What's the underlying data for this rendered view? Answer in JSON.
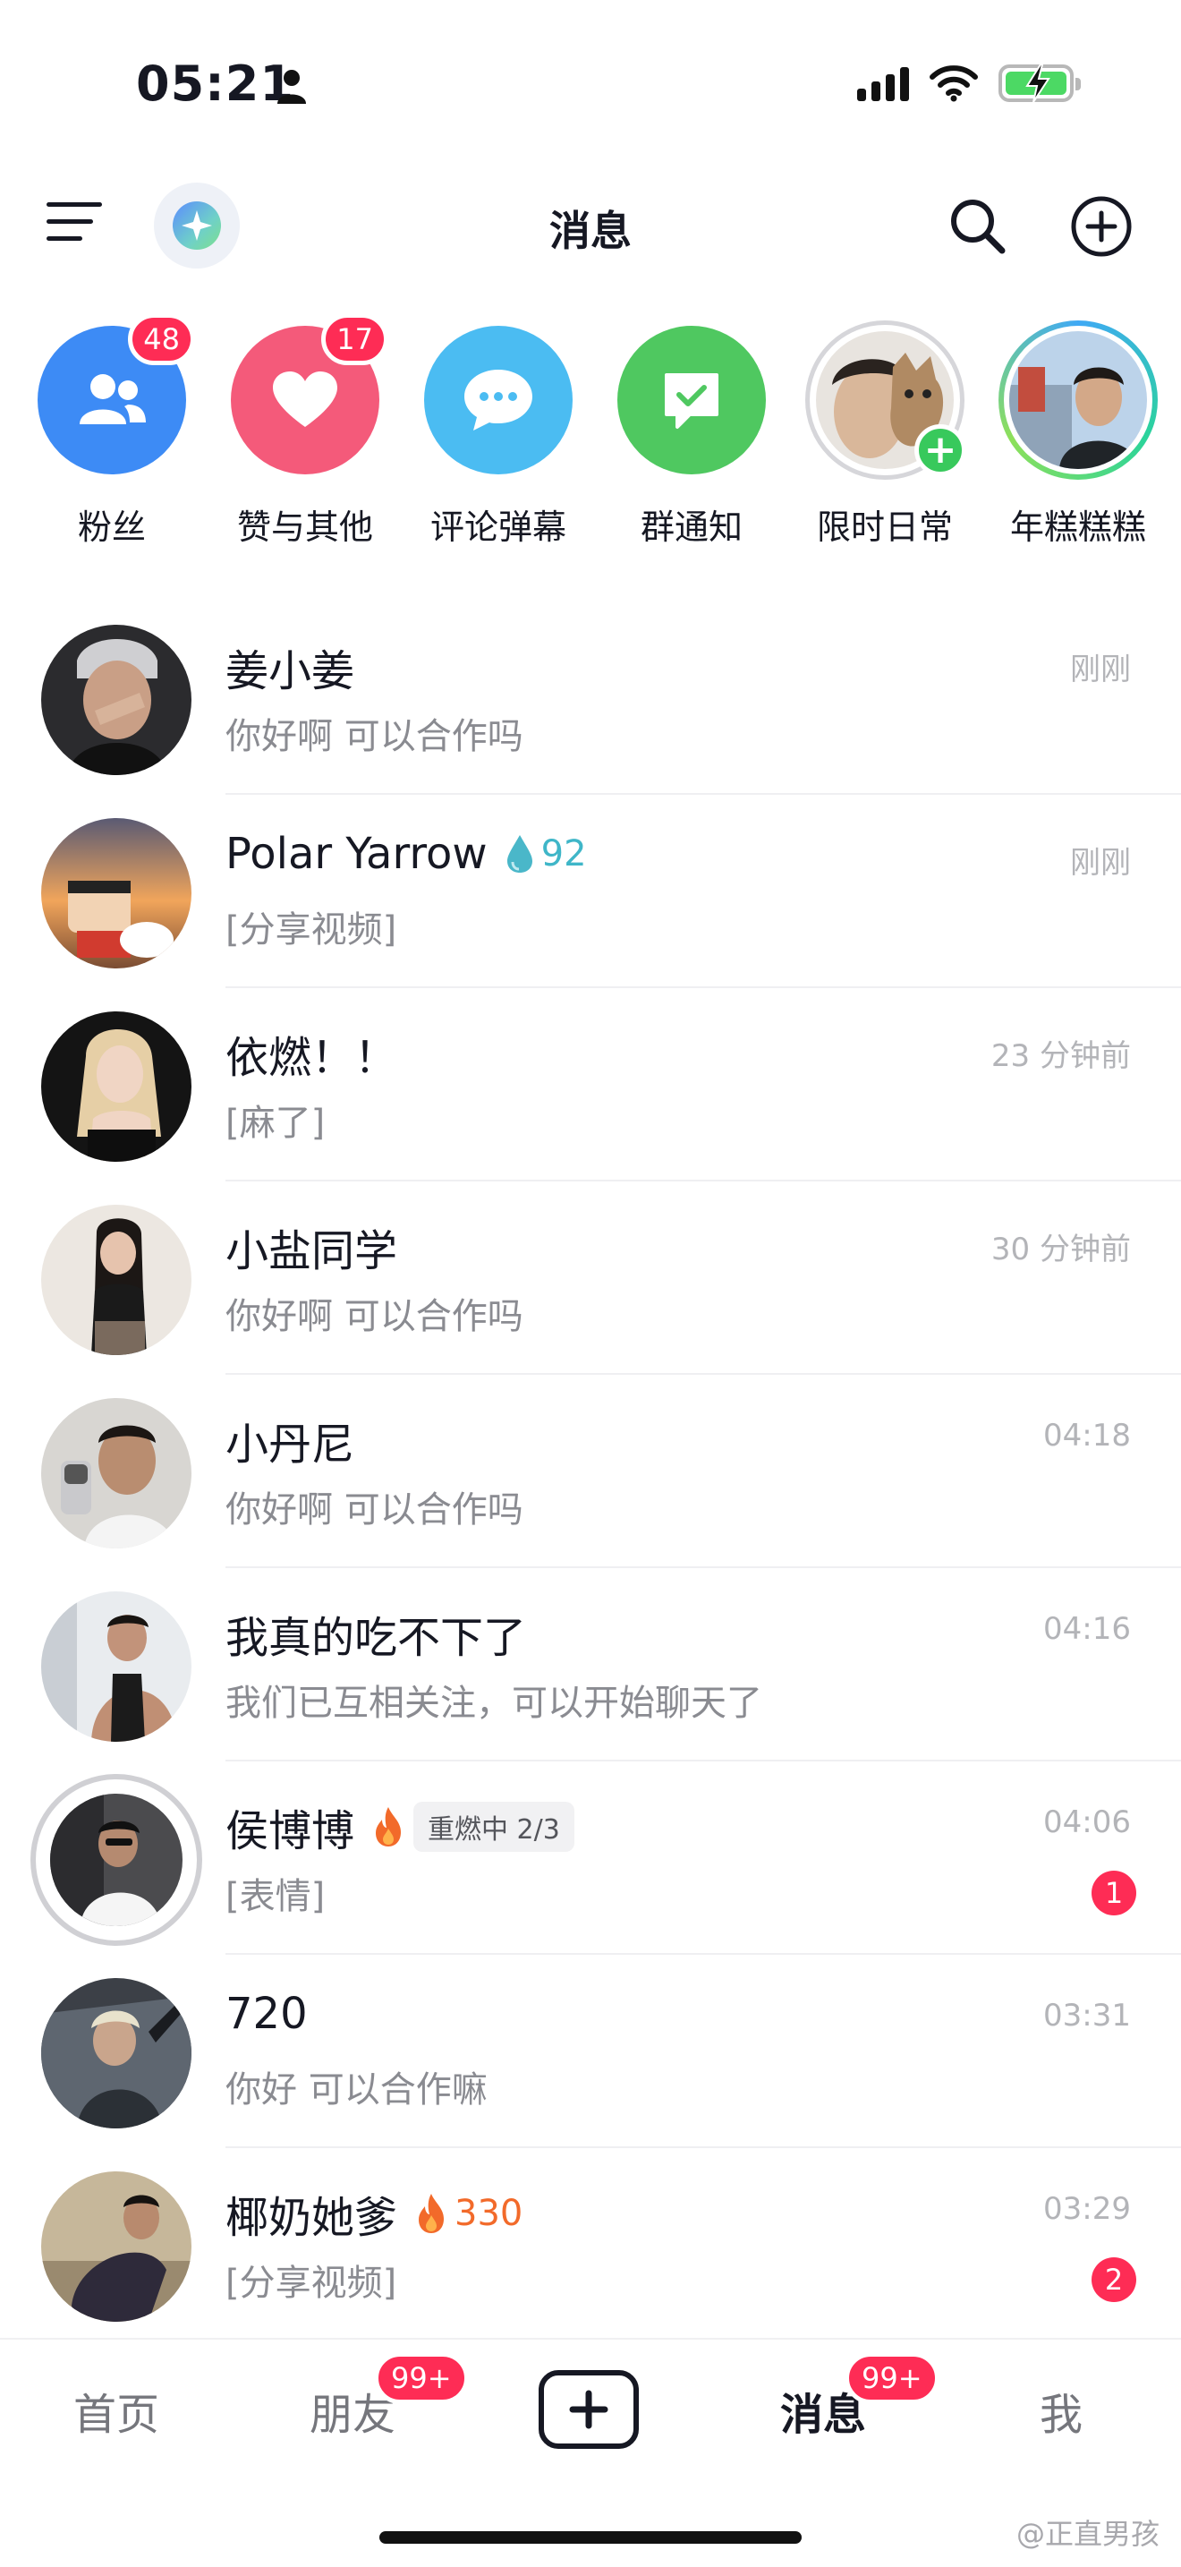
{
  "status_bar": {
    "time": "05:21"
  },
  "header": {
    "title": "消息"
  },
  "stories": [
    {
      "label": "粉丝",
      "badge": "48",
      "color": "#3d8bf5",
      "icon": "people-icon"
    },
    {
      "label": "赞与其他",
      "badge": "17",
      "color": "#f45a7a",
      "icon": "heart-icon"
    },
    {
      "label": "评论弹幕",
      "badge": "",
      "color": "#4bbcf2",
      "icon": "comment-icon"
    },
    {
      "label": "群通知",
      "badge": "",
      "color": "#4fc860",
      "icon": "check-message-icon"
    },
    {
      "label": "限时日常",
      "badge": "",
      "icon": "add-story-icon"
    },
    {
      "label": "年糕糕糕",
      "badge": "",
      "icon": "story-ring"
    }
  ],
  "messages": [
    {
      "name": "姜小姜",
      "preview": "你好啊 可以合作吗",
      "time": "刚刚"
    },
    {
      "name": "Polar Yarrow",
      "streak": "92",
      "preview": "[分享视频]",
      "time": "刚刚"
    },
    {
      "name": "依燃！！",
      "preview": "[麻了]",
      "time": "23 分钟前"
    },
    {
      "name": "小盐同学",
      "preview": "你好啊 可以合作吗",
      "time": "30 分钟前"
    },
    {
      "name": "小丹尼",
      "preview": "你好啊 可以合作吗",
      "time": "04:18"
    },
    {
      "name": "我真的吃不下了",
      "preview": "我们已互相关注，可以开始聊天了",
      "time": "04:16"
    },
    {
      "name": "侯博博",
      "rekindle": "重燃中 2/3",
      "preview": "[表情]",
      "time": "04:06",
      "unread": "1"
    },
    {
      "name": "720",
      "preview": "你好 可以合作嘛",
      "time": "03:31"
    },
    {
      "name": "椰奶她爹",
      "streak": "330",
      "preview": "[分享视频]",
      "time": "03:29",
      "unread": "2"
    }
  ],
  "tabbar": {
    "home": "首页",
    "friends": "朋友",
    "friends_badge": "99+",
    "messages": "消息",
    "messages_badge": "99+",
    "me": "我"
  },
  "watermark": "@正直男孩"
}
